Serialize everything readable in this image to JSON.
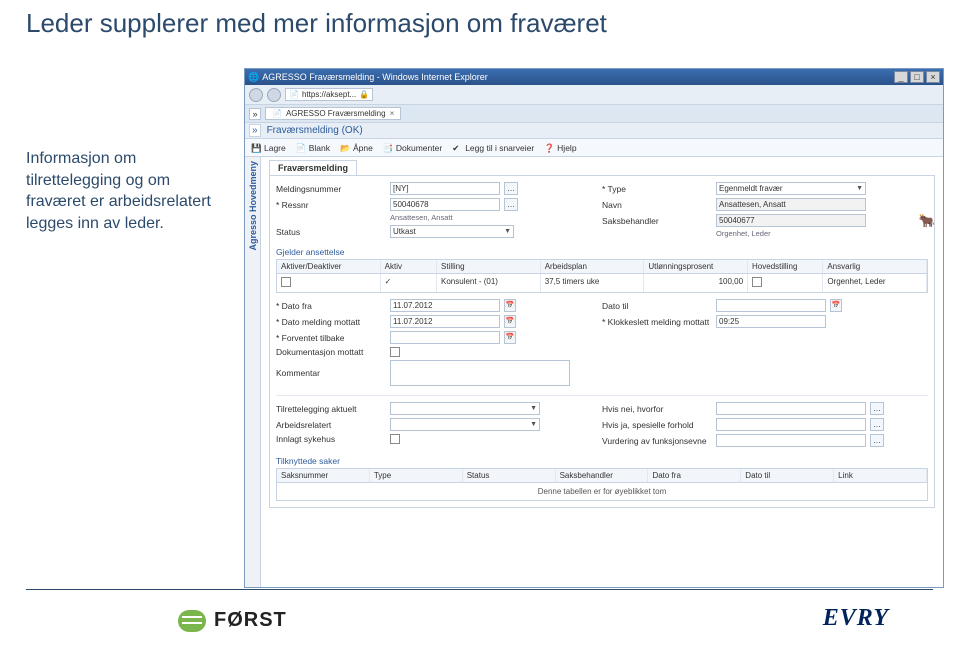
{
  "slide": {
    "title": "Leder supplerer med mer informasjon om fraværet",
    "side_note": "Informasjon om tilrettelegging og om fraværet er arbeidsrelatert legges inn av leder."
  },
  "window": {
    "title": "AGRESSO Fraværsmelding - Windows Internet Explorer",
    "url": "https://aksept...",
    "tab_label": "AGRESSO Fraværsmelding",
    "close": "×",
    "min": "_",
    "max": "□"
  },
  "app": {
    "header": "Fraværsmelding (OK)",
    "chevron": "»",
    "toolbar": {
      "lagre": "Lagre",
      "blank": "Blank",
      "apne": "Åpne",
      "dokumenter": "Dokumenter",
      "legg_til": "Legg til i snarveier",
      "hjelp": "Hjelp"
    },
    "sidemenu": "Agresso Hovedmeny",
    "form_tab": "Fraværsmelding"
  },
  "fields": {
    "meldingsnummer_lbl": "Meldingsnummer",
    "meldingsnummer_val": "[NY]",
    "type_lbl": "Type",
    "type_val": "Egenmeldt fravær",
    "ressnr_lbl": "Ressnr",
    "ressnr_val": "50040678",
    "ressnr_sub": "Ansattesen, Ansatt",
    "navn_lbl": "Navn",
    "navn_val": "Ansattesen, Ansatt",
    "status_lbl": "Status",
    "status_val": "Utkast",
    "saksbehandler_lbl": "Saksbehandler",
    "saksbehandler_val": "50040677",
    "saksbehandler_sub": "Orgenhet, Leder"
  },
  "ansettelse": {
    "title": "Gjelder ansettelse",
    "headers": [
      "Aktiver/Deaktiver",
      "Aktiv",
      "Stilling",
      "Arbeidsplan",
      "Utlønningsprosent",
      "Hovedstilling",
      "Ansvarlig"
    ],
    "row": {
      "aktiv": "✓",
      "stilling": "Konsulent - (01)",
      "arbeidsplan": "37,5 timers uke",
      "utlonn": "100,00",
      "hoved": "",
      "ansvarlig": "Orgenhet, Leder"
    }
  },
  "dates": {
    "dato_fra_lbl": "Dato fra",
    "dato_fra_val": "11.07.2012",
    "dato_til_lbl": "Dato til",
    "dato_mottatt_lbl": "Dato melding mottatt",
    "dato_mottatt_val": "11.07.2012",
    "klokke_lbl": "Klokkeslett melding mottatt",
    "klokke_val": "09:25",
    "forventet_lbl": "Forventet tilbake",
    "dok_lbl": "Dokumentasjon mottatt",
    "kommentar_lbl": "Kommentar"
  },
  "lower": {
    "tilrette_lbl": "Tilrettelegging aktuelt",
    "hvis_nei_lbl": "Hvis nei, hvorfor",
    "arbeidsrel_lbl": "Arbeidsrelatert",
    "hvis_ja_lbl": "Hvis ja, spesielle forhold",
    "innlagt_lbl": "Innlagt sykehus",
    "vurdering_lbl": "Vurdering av funksjonsevne"
  },
  "saker": {
    "title": "Tilknyttede saker",
    "headers": [
      "Saksnummer",
      "Type",
      "Status",
      "Saksbehandler",
      "Dato fra",
      "Dato til",
      "Link"
    ],
    "empty": "Denne tabellen er for øyeblikket tom"
  },
  "logos": {
    "forst": "FØRST",
    "evry": "EVRY"
  }
}
